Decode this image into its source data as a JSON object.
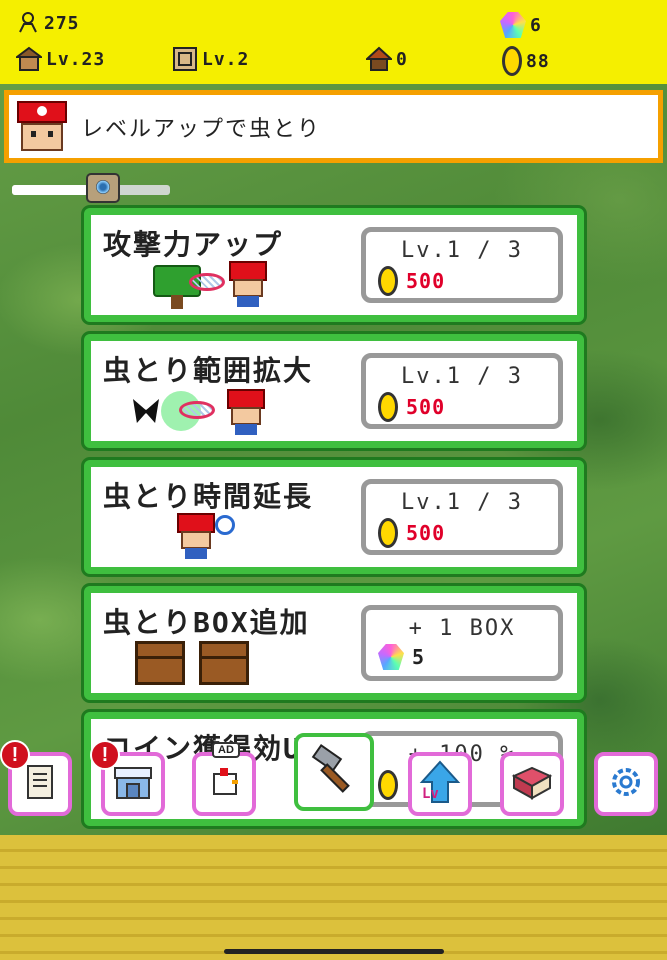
{
  "header": {
    "player_count": "275",
    "gems": "6",
    "house_level": "Lv.23",
    "box_level": "Lv.2",
    "hut_count": "0",
    "coins": "88"
  },
  "banner": {
    "message": "レベルアップで虫とり"
  },
  "progress": {
    "fraction": 0.48
  },
  "cards": [
    {
      "title": "攻撃力アップ",
      "level": "Lv.1 / 3",
      "cost": "500"
    },
    {
      "title": "虫とり範囲拡大",
      "level": "Lv.1 / 3",
      "cost": "500"
    },
    {
      "title": "虫とり時間延長",
      "level": "Lv.1 / 3",
      "cost": "500"
    },
    {
      "title": "虫とりBOX追加",
      "level": "+ 1 BOX",
      "cost": "5"
    },
    {
      "title": "コイン獲得効UP",
      "level": "+ 100 %"
    }
  ],
  "toolbar": {
    "ad_label": "AD",
    "alert_mark": "!"
  },
  "colors": {
    "header_bg": "#f5ef00",
    "banner_border": "#f5a000",
    "card_border": "#3fbf3f",
    "cost_red": "#e0002a",
    "toolbar_border": "#e26ad8"
  },
  "icons": [
    "player-icon",
    "gem-icon",
    "house-icon",
    "crate-icon",
    "hut-icon",
    "coin-icon",
    "camera-icon",
    "scroll-icon",
    "shop-icon",
    "chicken-icon",
    "hammer-icon",
    "level-up-icon",
    "book-icon",
    "gear-icon"
  ]
}
